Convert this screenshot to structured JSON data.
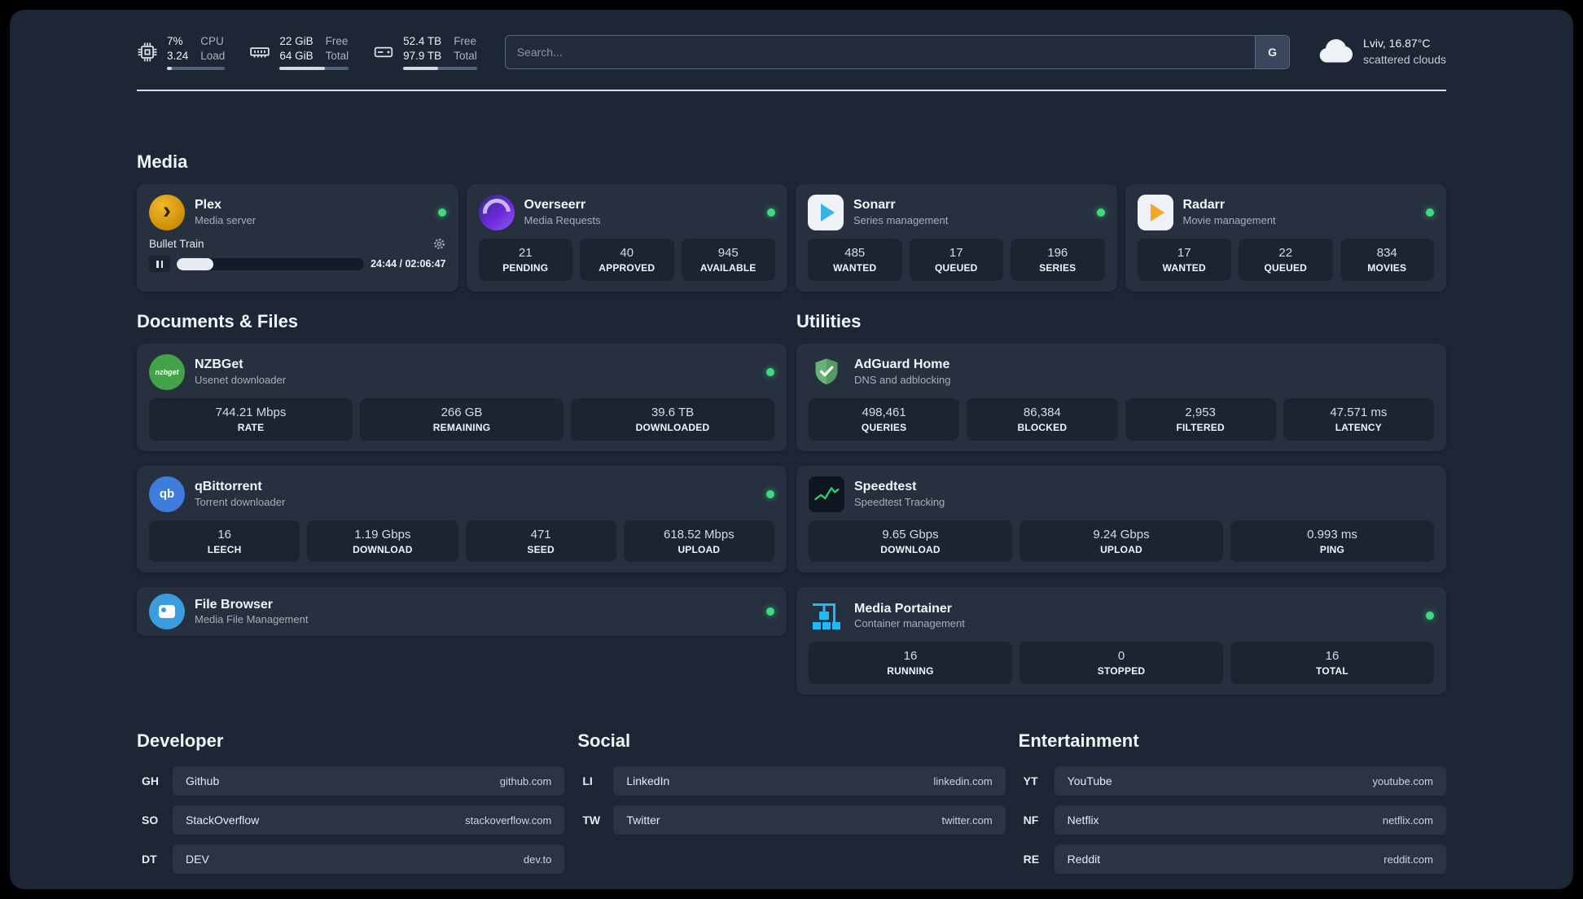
{
  "topbar": {
    "cpu": {
      "value_top": "7%",
      "value_bottom": "3.24",
      "label_top": "CPU",
      "label_bottom": "Load",
      "progress_pct": 8
    },
    "ram": {
      "value_top": "22 GiB",
      "value_bottom": "64 GiB",
      "label_top": "Free",
      "label_bottom": "Total",
      "progress_pct": 66
    },
    "disk": {
      "value_top": "52.4 TB",
      "value_bottom": "97.9 TB",
      "label_top": "Free",
      "label_bottom": "Total",
      "progress_pct": 47
    },
    "search": {
      "placeholder": "Search...",
      "button_label": "G"
    },
    "weather": {
      "location": "Lviv, 16.87°C",
      "condition": "scattered clouds"
    }
  },
  "media": {
    "title": "Media",
    "plex": {
      "name": "Plex",
      "subtitle": "Media server",
      "icon_glyph": "›",
      "player": {
        "track": "Bullet Train",
        "time": "24:44 / 02:06:47",
        "progress_pct": 19.5
      }
    },
    "overseerr": {
      "name": "Overseerr",
      "subtitle": "Media Requests",
      "stats": [
        {
          "value": "21",
          "label": "PENDING"
        },
        {
          "value": "40",
          "label": "APPROVED"
        },
        {
          "value": "945",
          "label": "AVAILABLE"
        }
      ]
    },
    "sonarr": {
      "name": "Sonarr",
      "subtitle": "Series management",
      "stats": [
        {
          "value": "485",
          "label": "WANTED"
        },
        {
          "value": "17",
          "label": "QUEUED"
        },
        {
          "value": "196",
          "label": "SERIES"
        }
      ]
    },
    "radarr": {
      "name": "Radarr",
      "subtitle": "Movie management",
      "stats": [
        {
          "value": "17",
          "label": "WANTED"
        },
        {
          "value": "22",
          "label": "QUEUED"
        },
        {
          "value": "834",
          "label": "MOVIES"
        }
      ]
    }
  },
  "documents": {
    "title": "Documents & Files",
    "nzbget": {
      "name": "NZBGet",
      "subtitle": "Usenet downloader",
      "icon_text": "nzbget",
      "stats": [
        {
          "value": "744.21 Mbps",
          "label": "RATE"
        },
        {
          "value": "266 GB",
          "label": "REMAINING"
        },
        {
          "value": "39.6 TB",
          "label": "DOWNLOADED"
        }
      ]
    },
    "qbittorrent": {
      "name": "qBittorrent",
      "subtitle": "Torrent downloader",
      "icon_text": "qb",
      "stats": [
        {
          "value": "16",
          "label": "LEECH"
        },
        {
          "value": "1.19 Gbps",
          "label": "DOWNLOAD"
        },
        {
          "value": "471",
          "label": "SEED"
        },
        {
          "value": "618.52 Mbps",
          "label": "UPLOAD"
        }
      ]
    },
    "filebrowser": {
      "name": "File Browser",
      "subtitle": "Media File Management"
    }
  },
  "utilities": {
    "title": "Utilities",
    "adguard": {
      "name": "AdGuard Home",
      "subtitle": "DNS and adblocking",
      "stats": [
        {
          "value": "498,461",
          "label": "QUERIES"
        },
        {
          "value": "86,384",
          "label": "BLOCKED"
        },
        {
          "value": "2,953",
          "label": "FILTERED"
        },
        {
          "value": "47.571 ms",
          "label": "LATENCY"
        }
      ]
    },
    "speedtest": {
      "name": "Speedtest",
      "subtitle": "Speedtest Tracking",
      "stats": [
        {
          "value": "9.65 Gbps",
          "label": "DOWNLOAD"
        },
        {
          "value": "9.24 Gbps",
          "label": "UPLOAD"
        },
        {
          "value": "0.993 ms",
          "label": "PING"
        }
      ]
    },
    "portainer": {
      "name": "Media Portainer",
      "subtitle": "Container management",
      "stats": [
        {
          "value": "16",
          "label": "RUNNING"
        },
        {
          "value": "0",
          "label": "STOPPED"
        },
        {
          "value": "16",
          "label": "TOTAL"
        }
      ]
    }
  },
  "bookmarks": {
    "developer": {
      "title": "Developer",
      "items": [
        {
          "abbr": "GH",
          "name": "Github",
          "url": "github.com"
        },
        {
          "abbr": "SO",
          "name": "StackOverflow",
          "url": "stackoverflow.com"
        },
        {
          "abbr": "DT",
          "name": "DEV",
          "url": "dev.to"
        }
      ]
    },
    "social": {
      "title": "Social",
      "items": [
        {
          "abbr": "LI",
          "name": "LinkedIn",
          "url": "linkedin.com"
        },
        {
          "abbr": "TW",
          "name": "Twitter",
          "url": "twitter.com"
        }
      ]
    },
    "entertainment": {
      "title": "Entertainment",
      "items": [
        {
          "abbr": "YT",
          "name": "YouTube",
          "url": "youtube.com"
        },
        {
          "abbr": "NF",
          "name": "Netflix",
          "url": "netflix.com"
        },
        {
          "abbr": "RE",
          "name": "Reddit",
          "url": "reddit.com"
        }
      ]
    }
  }
}
